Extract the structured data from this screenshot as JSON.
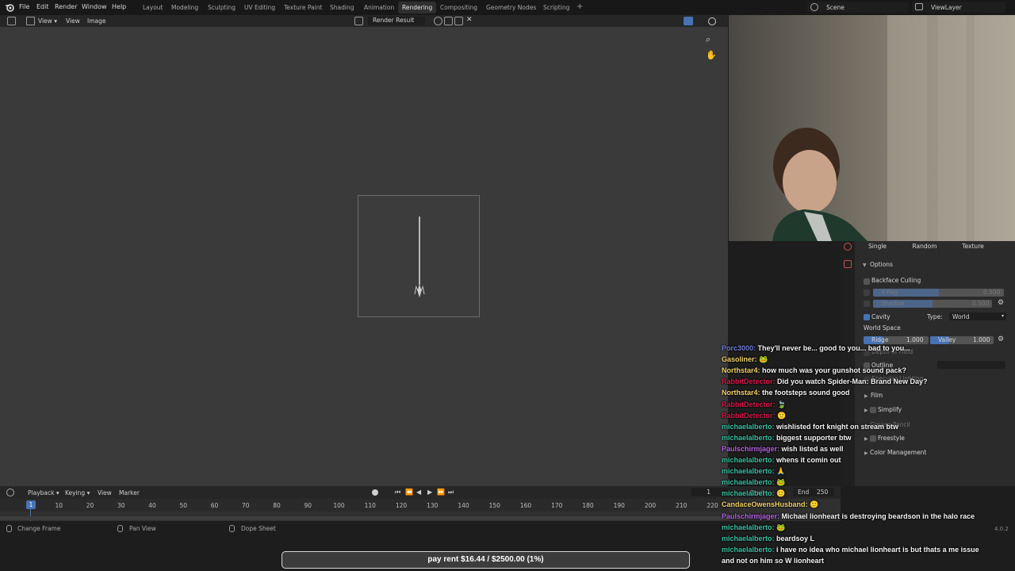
{
  "topbar": {
    "menus": [
      "File",
      "Edit",
      "Render",
      "Window",
      "Help"
    ],
    "workspaces": [
      "Layout",
      "Modeling",
      "Sculpting",
      "UV Editing",
      "Texture Paint",
      "Shading",
      "Animation",
      "Rendering",
      "Compositing",
      "Geometry Nodes",
      "Scripting"
    ],
    "active_workspace": "Rendering",
    "plus": "+",
    "scene": "Scene",
    "view_layer": "ViewLayer"
  },
  "image_editor": {
    "menus": [
      "View",
      "Image"
    ],
    "image_name": "Render Result"
  },
  "properties": {
    "color_modes": [
      "Single",
      "Random",
      "Texture"
    ],
    "options_label": "Options",
    "backface_culling": "Backface Culling",
    "xray_label": "X-Ray",
    "xray_value": "0.500",
    "shadow_label": "Shadow",
    "shadow_value": "0.500",
    "cavity_label": "Cavity",
    "type_label": "Type:",
    "type_value": "World",
    "world_space_label": "World Space",
    "ridge_label": "Ridge",
    "ridge_value": "1.000",
    "valley_label": "Valley",
    "valley_value": "1.000",
    "depth_of_field": "Depth of Field",
    "outline": "Outline",
    "specular_lighting": "Specular Lighting",
    "film": "Film",
    "simplify": "Simplify",
    "grease_pencil": "Grease Pencil",
    "freestyle": "Freestyle",
    "color_management": "Color Management",
    "accent": "#4772b3"
  },
  "timeline": {
    "menus": [
      "Playback",
      "Keying",
      "View",
      "Marker"
    ],
    "current_frame": "1",
    "ticks": [
      "10",
      "20",
      "30",
      "40",
      "50",
      "60",
      "70",
      "80",
      "90",
      "100",
      "110",
      "120",
      "130",
      "140",
      "150",
      "160",
      "170",
      "180",
      "190",
      "200",
      "210",
      "220"
    ],
    "frame_field": "1",
    "start_label": "Start",
    "end_label": "End",
    "end_value": "250"
  },
  "status_bar": {
    "items": [
      "Change Frame",
      "Pan View",
      "Dope Sheet"
    ],
    "version": "4.0.2"
  },
  "chat": [
    {
      "user": "Porc3000",
      "color": "#6f7fd6",
      "text": "They'll never be... good to you... bad to you..."
    },
    {
      "user": "Gasoliner",
      "color": "#f0d36a",
      "text": "🐸"
    },
    {
      "user": "Northstar4",
      "color": "#f0d36a",
      "text": "how much was your gunshot sound pack?"
    },
    {
      "user": "RabbitDetector",
      "color": "#d8184a",
      "text": "Did you watch Spider-Man: Brand New Day?"
    },
    {
      "user": "Northstar4",
      "color": "#f0d36a",
      "text": "the footsteps sound good"
    },
    {
      "user": "RabbitDetector",
      "color": "#d8184a",
      "text": "🍃"
    },
    {
      "user": "RabbitDetector",
      "color": "#d8184a",
      "text": "🙂"
    },
    {
      "user": "michaelalberto",
      "color": "#3bbfa1",
      "text": "wishlisted fort knight on stream btw"
    },
    {
      "user": "michaelalberto",
      "color": "#3bbfa1",
      "text": "biggest supporter btw"
    },
    {
      "user": "Paulschirmjager",
      "color": "#b463e0",
      "text": "wish listed as well"
    },
    {
      "user": "michaelalberto",
      "color": "#3bbfa1",
      "text": "whens it comin out"
    },
    {
      "user": "michaelalberto",
      "color": "#3bbfa1",
      "text": "🙏"
    },
    {
      "user": "michaelalberto",
      "color": "#3bbfa1",
      "text": "🐸"
    },
    {
      "user": "michaelalberto",
      "color": "#3bbfa1",
      "text": "🙂"
    },
    {
      "user": "CandaceOwensHusband",
      "color": "#f0d36a",
      "text": "🙂"
    },
    {
      "user": "Paulschirmjager",
      "color": "#b463e0",
      "text": "Michael lionheart is destroying beardson in the halo race"
    },
    {
      "user": "michaelalberto",
      "color": "#3bbfa1",
      "text": "🐸"
    },
    {
      "user": "michaelalberto",
      "color": "#3bbfa1",
      "text": "beardsoy L"
    },
    {
      "user": "michaelalberto",
      "color": "#3bbfa1",
      "text": "i have no idea who michael lionheart is but thats a me issue"
    },
    {
      "user": "",
      "color": "#f4f4f4",
      "text": "and not on him so W lionheart"
    }
  ],
  "goal": {
    "text": "pay rent $16.44 / $2500.00 (1%)",
    "progress": 0.0066
  }
}
